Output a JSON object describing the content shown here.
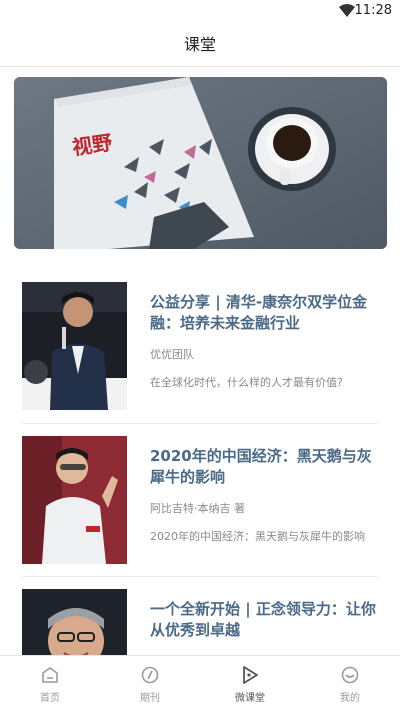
{
  "status_bar": {
    "time": "11:28"
  },
  "header": {
    "title": "课堂"
  },
  "banner": {
    "cover_text": "视野"
  },
  "courses": [
    {
      "title": "公益分享 | 清华-康奈尔双学位金融：培养未来金融行业",
      "author": "优优团队",
      "description": "在全球化时代，什么样的人才最有价值?"
    },
    {
      "title": "2020年的中国经济：黑天鹅与灰犀牛的影响",
      "author": "阿比吉特·本纳吉 著",
      "description": "2020年的中国经济：黑天鹅与灰犀牛的影响"
    },
    {
      "title": "一个全新开始 | 正念领导力：让你从优秀到卓越",
      "author": "",
      "description": ""
    }
  ],
  "tab_bar": {
    "items": [
      {
        "label": "首页",
        "icon": "home-icon"
      },
      {
        "label": "期刊",
        "icon": "journal-icon"
      },
      {
        "label": "微课堂",
        "icon": "play-icon"
      },
      {
        "label": "我的",
        "icon": "profile-icon"
      }
    ],
    "active_index": 2
  }
}
